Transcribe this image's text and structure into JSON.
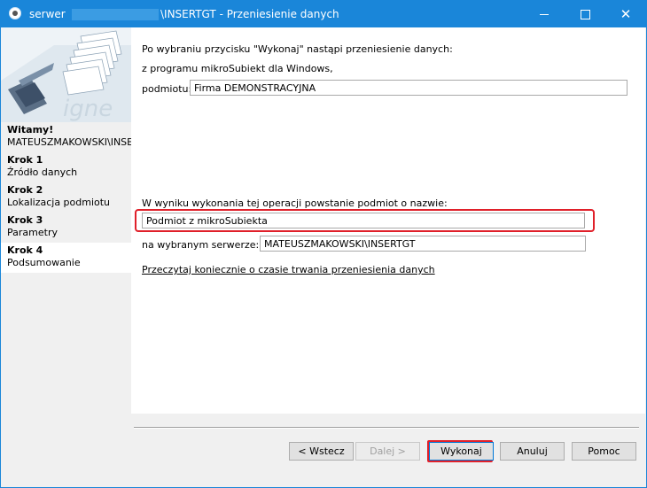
{
  "window": {
    "title_prefix": "serwer",
    "title_suffix": "\\INSERTGT - Przeniesienie danych"
  },
  "sidebar": {
    "steps": [
      {
        "title": "Witamy!",
        "sub": "MATEUSZMAKOWSKI\\INSE"
      },
      {
        "title": "Krok 1",
        "sub": "Źródło danych"
      },
      {
        "title": "Krok 2",
        "sub": "Lokalizacja podmiotu"
      },
      {
        "title": "Krok 3",
        "sub": "Parametry"
      },
      {
        "title": "Krok 4",
        "sub": "Podsumowanie"
      }
    ]
  },
  "main": {
    "intro": "Po wybraniu przycisku \"Wykonaj\" nastąpi przeniesienie danych:",
    "from_program": " z programu mikroSubiekt dla Windows,",
    "podmiot_label": "podmiotu:",
    "podmiot_value": "Firma DEMONSTRACYJNA",
    "result_label": "W wyniku wykonania tej operacji powstanie podmiot o nazwie:",
    "result_value": "Podmiot z mikroSubiekta",
    "server_label": "na wybranym serwerze:",
    "server_value": "MATEUSZMAKOWSKI\\INSERTGT",
    "link": "Przeczytaj koniecznie o czasie trwania przeniesienia danych"
  },
  "buttons": {
    "back": "< Wstecz",
    "next": "Dalej >",
    "execute": "Wykonaj",
    "cancel": "Anuluj",
    "help": "Pomoc"
  },
  "colors": {
    "titlebar": "#1a86d9",
    "highlight": "#e0202a"
  }
}
